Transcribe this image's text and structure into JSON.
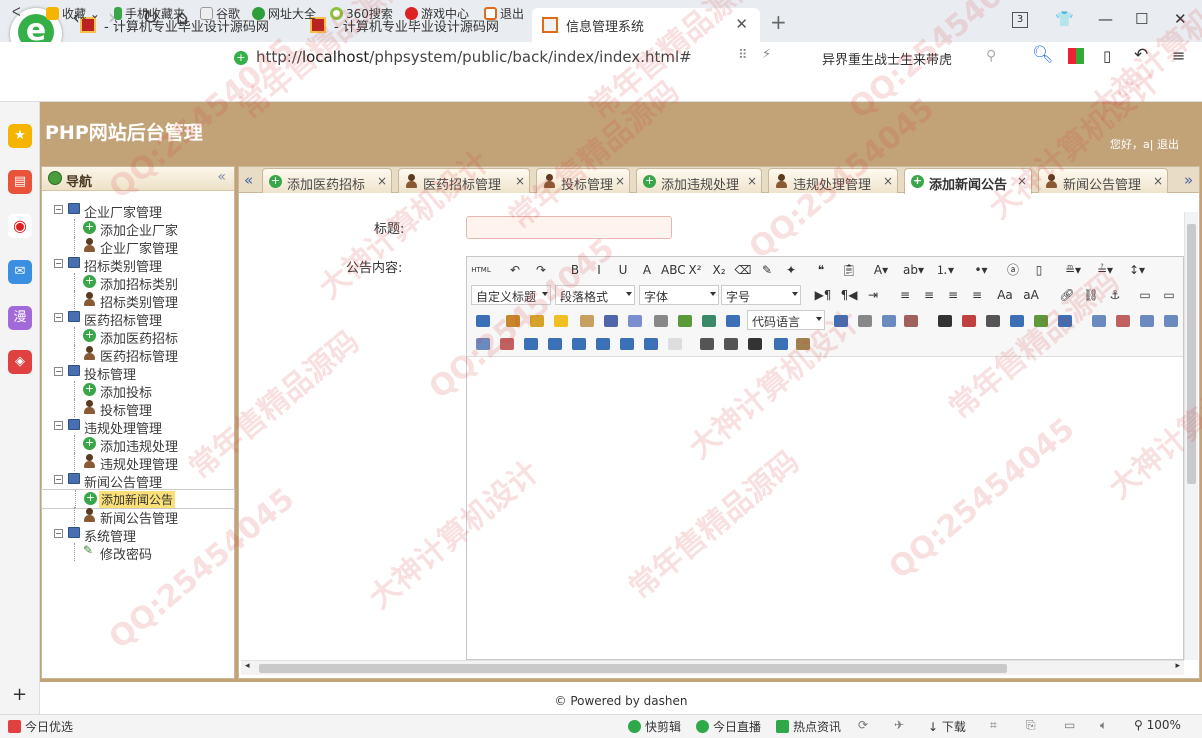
{
  "browser": {
    "tabs": [
      {
        "label": "- 计算机专业毕业设计源码网"
      },
      {
        "label": "- 计算机专业毕业设计源码网"
      },
      {
        "label": "信息管理系统"
      }
    ],
    "tab_count": "3",
    "url_prefix": "http://",
    "url_host": "localhost",
    "url_path": "/phpsystem/public/back/index/index.html#",
    "search_text": "异界重生战士生来带虎",
    "bookmarks": [
      "收藏",
      "手机收藏夹",
      "谷歌",
      "网址大全",
      "360搜索",
      "游戏中心",
      "退出"
    ]
  },
  "app": {
    "title": "PHP网站后台管理",
    "greeting": "您好，a|",
    "logout": "退出",
    "footer": "© Powered by dashen"
  },
  "sidebar": {
    "title": "导航",
    "groups": [
      {
        "label": "企业厂家管理",
        "children": [
          "添加企业厂家",
          "企业厂家管理"
        ]
      },
      {
        "label": "招标类别管理",
        "children": [
          "添加招标类别",
          "招标类别管理"
        ]
      },
      {
        "label": "医药招标管理",
        "children": [
          "添加医药招标",
          "医药招标管理"
        ]
      },
      {
        "label": "投标管理",
        "children": [
          "添加投标",
          "投标管理"
        ]
      },
      {
        "label": "违规处理管理",
        "children": [
          "添加违规处理",
          "违规处理管理"
        ]
      },
      {
        "label": "新闻公告管理",
        "children": [
          "添加新闻公告",
          "新闻公告管理"
        ]
      },
      {
        "label": "系统管理",
        "children": [
          "修改密码"
        ]
      }
    ],
    "selected": "添加新闻公告"
  },
  "tabs": [
    {
      "label": "添加医药招标",
      "icon": "plus-icon"
    },
    {
      "label": "医药招标管理",
      "icon": "user-icon"
    },
    {
      "label": "投标管理",
      "icon": "user-icon"
    },
    {
      "label": "添加违规处理",
      "icon": "plus-icon"
    },
    {
      "label": "违规处理管理",
      "icon": "user-icon"
    },
    {
      "label": "添加新闻公告",
      "icon": "plus-icon",
      "active": true
    },
    {
      "label": "新闻公告管理",
      "icon": "user-icon"
    }
  ],
  "form": {
    "title_label": "标题:",
    "title_value": "",
    "content_label": "公告内容:"
  },
  "editor": {
    "html_btn": "HTML",
    "custom_heading": "自定义标题",
    "paragraph_format": "段落格式",
    "font_family": "字体",
    "font_size": "字号",
    "code_language": "代码语言"
  },
  "statusbar": {
    "left": "今日优选",
    "items": [
      "快剪辑",
      "今日直播",
      "热点资讯"
    ],
    "download": "下载",
    "zoom": "100%"
  },
  "watermark": [
    "QQ:25454045",
    "大神计算机设计",
    "常年售精品源码"
  ]
}
